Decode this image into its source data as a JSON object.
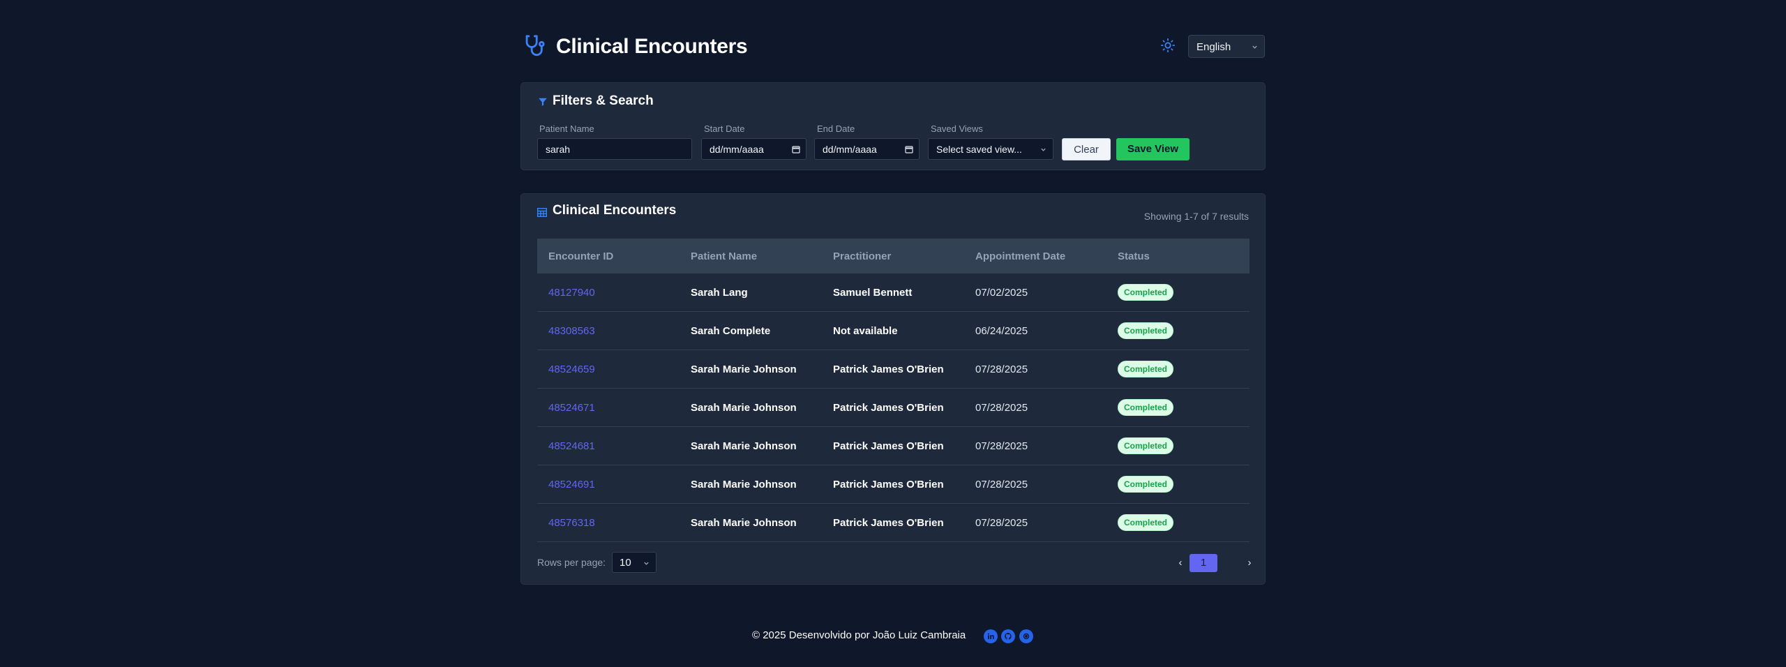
{
  "header": {
    "title": "Clinical Encounters",
    "language": "English",
    "icons": {
      "logo": "stethoscope-icon",
      "theme": "sun-icon"
    }
  },
  "filters": {
    "title": "Filters & Search",
    "patient_name_label": "Patient Name",
    "patient_name_value": "sarah",
    "start_date_label": "Start Date",
    "start_date_value": "dd/mm/aaaa",
    "end_date_label": "End Date",
    "end_date_value": "dd/mm/aaaa",
    "saved_views_label": "Saved Views",
    "saved_views_value": "Select saved view...",
    "clear_label": "Clear",
    "save_view_label": "Save View"
  },
  "table": {
    "title": "Clinical Encounters",
    "results_info": "Showing 1-7 of 7 results",
    "columns": [
      "Encounter ID",
      "Patient Name",
      "Practitioner",
      "Appointment Date",
      "Status"
    ],
    "rows": [
      {
        "id": "48127940",
        "patient": "Sarah Lang",
        "practitioner": "Samuel Bennett",
        "date": "07/02/2025",
        "status": "Completed"
      },
      {
        "id": "48308563",
        "patient": "Sarah Complete",
        "practitioner": "Not available",
        "date": "06/24/2025",
        "status": "Completed"
      },
      {
        "id": "48524659",
        "patient": "Sarah Marie Johnson",
        "practitioner": "Patrick James O'Brien",
        "date": "07/28/2025",
        "status": "Completed"
      },
      {
        "id": "48524671",
        "patient": "Sarah Marie Johnson",
        "practitioner": "Patrick James O'Brien",
        "date": "07/28/2025",
        "status": "Completed"
      },
      {
        "id": "48524681",
        "patient": "Sarah Marie Johnson",
        "practitioner": "Patrick James O'Brien",
        "date": "07/28/2025",
        "status": "Completed"
      },
      {
        "id": "48524691",
        "patient": "Sarah Marie Johnson",
        "practitioner": "Patrick James O'Brien",
        "date": "07/28/2025",
        "status": "Completed"
      },
      {
        "id": "48576318",
        "patient": "Sarah Marie Johnson",
        "practitioner": "Patrick James O'Brien",
        "date": "07/28/2025",
        "status": "Completed"
      }
    ],
    "rows_per_page_label": "Rows per page:",
    "rows_per_page_value": "10",
    "pager_prev": "‹",
    "current_page": "1",
    "pager_next": "›"
  },
  "footer": {
    "text": "© 2025 Desenvolvido por João Luiz Cambraia",
    "social": [
      "linkedin-icon",
      "github-icon",
      "website-icon"
    ]
  },
  "colors": {
    "background": "#0f172a",
    "card": "#1e293b",
    "accent": "#6366f1",
    "success": "#22c55e",
    "icon_blue": "#2563eb"
  }
}
